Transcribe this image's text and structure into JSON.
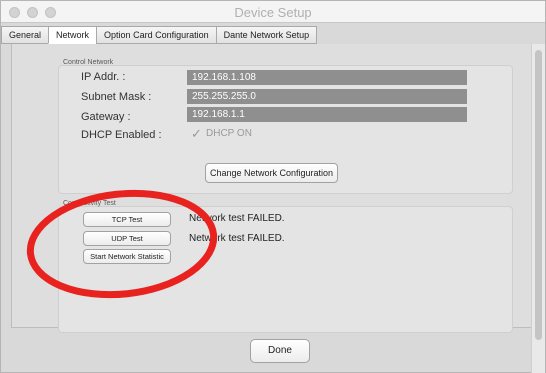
{
  "window": {
    "title": "Device Setup"
  },
  "tabs": [
    {
      "label": "General"
    },
    {
      "label": "Network"
    },
    {
      "label": "Option Card Configuration"
    },
    {
      "label": "Dante Network Setup"
    }
  ],
  "control_network": {
    "group_label": "Control Network",
    "fields": [
      {
        "label": "IP Addr. :",
        "value": "192.168.1.108"
      },
      {
        "label": "Subnet Mask :",
        "value": "255.255.255.0"
      },
      {
        "label": "Gateway :",
        "value": "192.168.1.1"
      }
    ],
    "dhcp": {
      "label": "DHCP Enabled :",
      "checkmark": "✓",
      "text": "DHCP ON"
    },
    "change_button": "Change Network Configuration"
  },
  "connectivity": {
    "group_label": "Connectivity Test",
    "tcp_button": "TCP Test",
    "tcp_status": "Network test FAILED.",
    "udp_button": "UDP Test",
    "udp_status": "Network test FAILED.",
    "stat_button": "Start Network Statistic"
  },
  "footer": {
    "done_button": "Done"
  },
  "colors": {
    "annotation": "#e8231f",
    "field_bg": "#8f8f8f"
  },
  "icons": {
    "checkmark": "checkmark-icon"
  }
}
